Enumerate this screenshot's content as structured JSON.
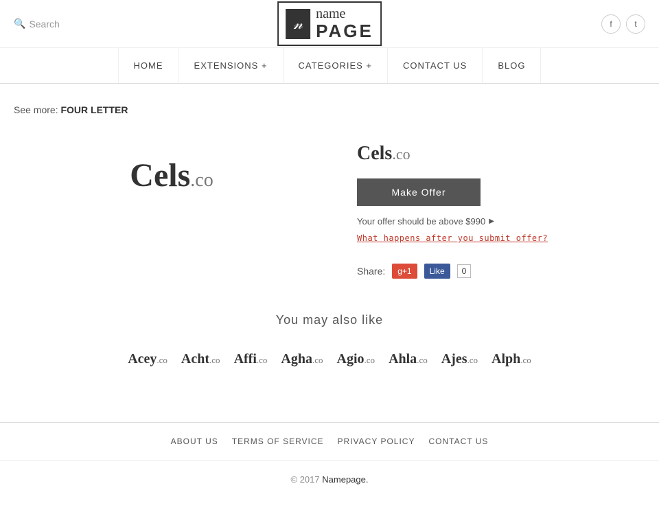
{
  "header": {
    "search_label": "Search",
    "logo_italic": "n",
    "logo_name": "name",
    "logo_page": "PAGE",
    "social": [
      {
        "name": "facebook",
        "icon": "f"
      },
      {
        "name": "twitter",
        "icon": "t"
      }
    ]
  },
  "nav": {
    "items": [
      {
        "label": "HOME",
        "has_dropdown": false
      },
      {
        "label": "EXTENSIONS +",
        "has_dropdown": true
      },
      {
        "label": "CATEGORIES +",
        "has_dropdown": true
      },
      {
        "label": "CONTACT US",
        "has_dropdown": false
      },
      {
        "label": "BLOG",
        "has_dropdown": false
      }
    ]
  },
  "see_more": {
    "prefix": "See more:",
    "link_text": "FOUR LETTER"
  },
  "domain": {
    "name": "Cels",
    "tld": ".co",
    "full": "Cels.co",
    "make_offer_label": "Make Offer",
    "offer_hint": "Your offer should be above $990",
    "what_happens": "What happens after you submit offer?",
    "share_label": "Share:",
    "gplus_label": "g+1",
    "fb_label": "Like",
    "fb_count": "0"
  },
  "also_like": {
    "title": "You may also like",
    "domains": [
      {
        "name": "Acey",
        "tld": ".co"
      },
      {
        "name": "Acht",
        "tld": ".co"
      },
      {
        "name": "Affi",
        "tld": ".co"
      },
      {
        "name": "Agha",
        "tld": ".co"
      },
      {
        "name": "Agio",
        "tld": ".co"
      },
      {
        "name": "Ahla",
        "tld": ".co"
      },
      {
        "name": "Ajes",
        "tld": ".co"
      },
      {
        "name": "Alph",
        "tld": ".co"
      }
    ]
  },
  "footer": {
    "nav_items": [
      {
        "label": "ABOUT US"
      },
      {
        "label": "TERMS OF SERVICE"
      },
      {
        "label": "PRIVACY POLICY"
      },
      {
        "label": "CONTACT US"
      }
    ],
    "copy_prefix": "© 2017",
    "copy_brand": "Namepage.",
    "copy_year": "2017"
  }
}
